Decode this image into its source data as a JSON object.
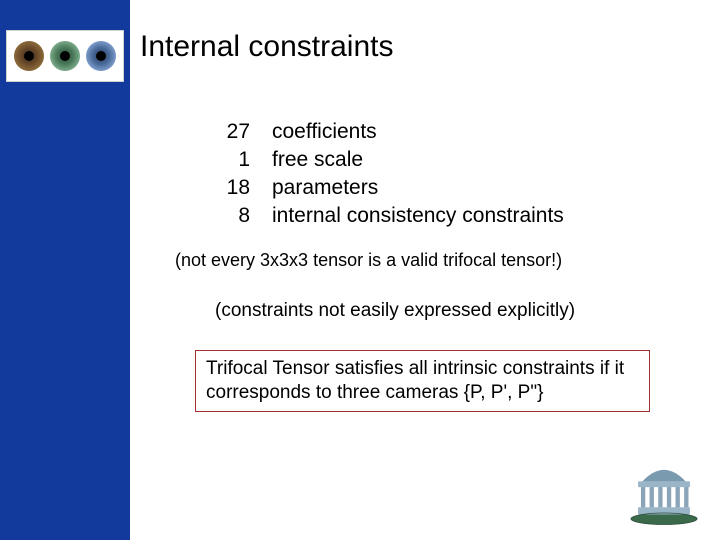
{
  "title": "Internal constraints",
  "rows": [
    {
      "n": "27",
      "label": "coefficients"
    },
    {
      "n": "1",
      "label": "free scale"
    },
    {
      "n": "18",
      "label": "parameters"
    },
    {
      "n": "8",
      "label": "internal consistency constraints"
    }
  ],
  "note1": "(not every 3x3x3 tensor is a valid trifocal tensor!)",
  "note2": "(constraints not easily expressed explicitly)",
  "boxnote": "Trifocal Tensor satisfies all intrinsic constraints if it corresponds to three cameras {P, P', P\"}",
  "logo_alt": "three-iris-logo",
  "monument_alt": "rotunda-monument"
}
